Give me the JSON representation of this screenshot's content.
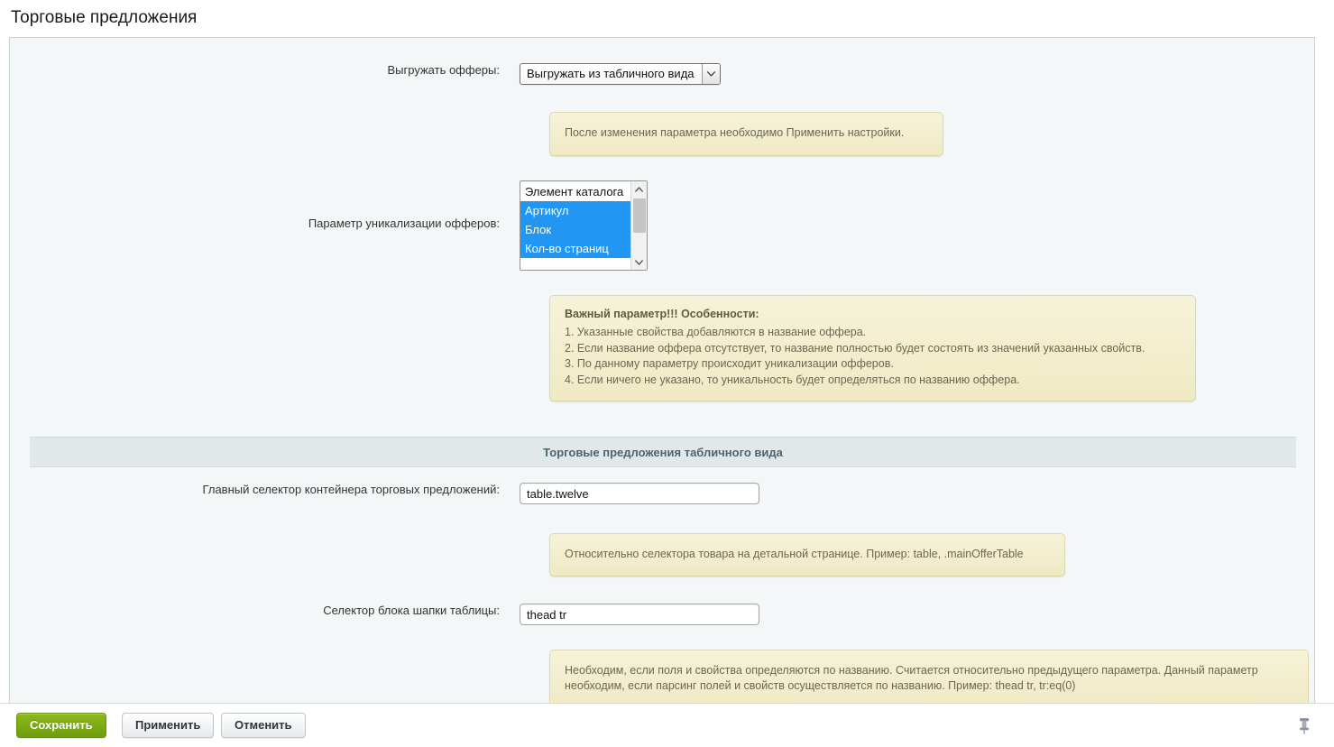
{
  "page": {
    "title": "Торговые предложения"
  },
  "fields": {
    "offers_mode": {
      "label": "Выгружать офферы:",
      "selected": "Выгружать из табличного вида",
      "options": [
        "Выгружать из табличного вида"
      ]
    },
    "unique_param": {
      "label": "Параметр уникализации офферов:",
      "options": [
        {
          "text": "Элемент каталога",
          "selected": false
        },
        {
          "text": "Артикул",
          "selected": true
        },
        {
          "text": "Блок",
          "selected": true
        },
        {
          "text": "Кол-во страниц",
          "selected": true
        }
      ]
    },
    "main_selector": {
      "label": "Главный селектор контейнера торговых предложений:",
      "value": "table.twelve",
      "placeholder": ""
    },
    "head_selector": {
      "label": "Селектор блока шапки таблицы:",
      "value": "thead tr",
      "placeholder": ""
    }
  },
  "notes": {
    "apply_settings": "После изменения параметра необходимо Применить настройки.",
    "important": {
      "title": "Важный параметр!!! Особенности:",
      "items": [
        "1. Указанные свойства добавляются в название оффера.",
        "2. Если название оффера отсутствует, то название полностью будет состоять из значений указанных свойств.",
        "3. По данному параметру происходит уникализации офферов.",
        "4. Если ничего не указано, то уникальность будет определяться по названию оффера."
      ]
    },
    "main_selector_hint": "Относительно селектора товара на детальной странице. Пример: table, .mainOfferTable",
    "head_selector_hint": "Необходим, если поля и свойства определяются по названию. Считается относительно предыдущего параметра. Данный параметр необходим, если парсинг полей и свойств осуществляется по названию. Пример: thead tr, tr:eq(0)"
  },
  "sections": {
    "table_offers": "Торговые предложения табличного вида"
  },
  "toolbar": {
    "save_label": "Сохранить",
    "apply_label": "Применить",
    "cancel_label": "Отменить",
    "pin_icon": "pushpin-icon"
  },
  "colors": {
    "accent_save": "#7ea914",
    "panel_bg": "#f4f7f8",
    "note_bg": "#f1ecd0",
    "selection_blue": "#2196f3",
    "section_bg": "#e1e8ea"
  }
}
